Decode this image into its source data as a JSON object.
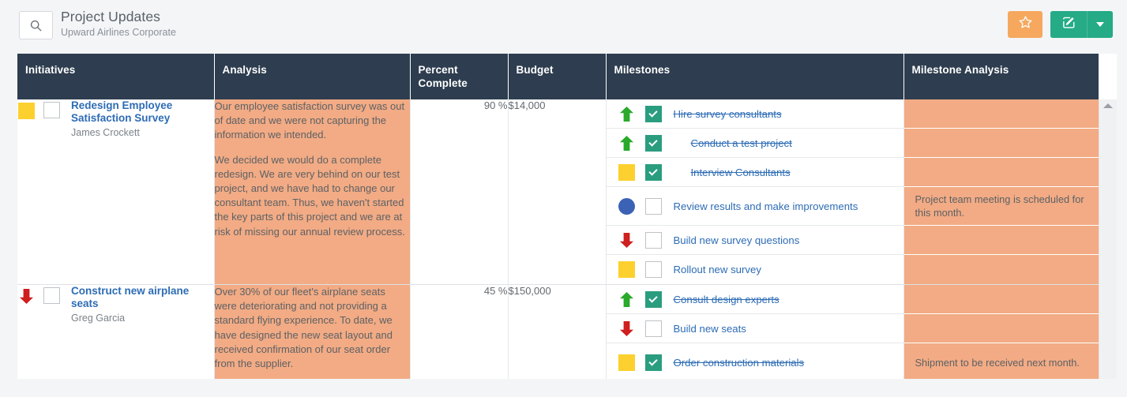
{
  "header": {
    "title": "Project Updates",
    "subtitle": "Upward Airlines Corporate",
    "search_icon": "search-icon",
    "star_icon": "star-icon",
    "edit_icon": "edit-pencil-icon",
    "caret_icon": "chevron-down-icon",
    "star_button_color": "#f5a85e",
    "edit_button_color": "#25ab86"
  },
  "columns": [
    {
      "key": "initiatives",
      "label": "Initiatives"
    },
    {
      "key": "analysis",
      "label": "Analysis"
    },
    {
      "key": "percent_complete",
      "label": "Percent Complete"
    },
    {
      "key": "budget",
      "label": "Budget"
    },
    {
      "key": "milestones",
      "label": "Milestones"
    },
    {
      "key": "milestone_analysis",
      "label": "Milestone Analysis"
    }
  ],
  "colors": {
    "header_bg": "#2e3d4f",
    "analysis_bg": "#f2ab84",
    "link": "#2d6cb5",
    "status_yellow": "#fcd02e",
    "status_green": "#2aa92a",
    "status_red": "#cf1f1f",
    "status_blue": "#3b62b5",
    "checkbox_checked": "#2a9d7f"
  },
  "rows": [
    {
      "status_icon": "yellow-square-status-icon",
      "status_type": "square-yellow",
      "checked": false,
      "title": "Redesign Employee Satisfaction Survey",
      "owner": "James Crockett",
      "analysis_paragraphs": [
        "Our employee satisfaction survey was out of date and we were not capturing the information we intended.",
        "We decided we would do a complete redesign. We are very behind on our test project, and we have had to change our consultant team. Thus, we haven't started the key parts of this project and we are at risk of missing our annual review process."
      ],
      "percent_complete": "90 %",
      "budget": "$14,000",
      "milestones": [
        {
          "status_icon": "green-up-arrow-status-icon",
          "status_type": "arrow-up-green",
          "checked": true,
          "label": "Hire survey consultants",
          "struck": true,
          "indent": false,
          "analysis": "",
          "tall": false
        },
        {
          "status_icon": "green-up-arrow-status-icon",
          "status_type": "arrow-up-green",
          "checked": true,
          "label": "Conduct a test project",
          "struck": true,
          "indent": true,
          "analysis": "",
          "tall": false
        },
        {
          "status_icon": "yellow-square-status-icon",
          "status_type": "square-yellow",
          "checked": true,
          "label": "Interview Consultants",
          "struck": true,
          "indent": true,
          "analysis": "",
          "tall": false
        },
        {
          "status_icon": "blue-circle-status-icon",
          "status_type": "circle-blue",
          "checked": false,
          "label": "Review results and make improvements",
          "struck": false,
          "indent": false,
          "analysis": "Project team meeting is scheduled for this month.",
          "tall": true
        },
        {
          "status_icon": "red-down-arrow-status-icon",
          "status_type": "arrow-down-red",
          "checked": false,
          "label": "Build new survey questions",
          "struck": false,
          "indent": false,
          "analysis": "",
          "tall": false
        },
        {
          "status_icon": "yellow-square-status-icon",
          "status_type": "square-yellow",
          "checked": false,
          "label": "Rollout new survey",
          "struck": false,
          "indent": false,
          "analysis": "",
          "tall": false
        }
      ]
    },
    {
      "status_icon": "red-down-arrow-status-icon",
      "status_type": "arrow-down-red",
      "checked": false,
      "title": "Construct new airplane seats",
      "owner": "Greg Garcia",
      "analysis_paragraphs": [
        "Over 30% of our fleet's airplane seats were deteriorating and not providing a standard flying experience. To date, we have designed the new seat layout and received confirmation of our seat order from the supplier."
      ],
      "percent_complete": "45 %",
      "budget": "$150,000",
      "milestones": [
        {
          "status_icon": "green-up-arrow-status-icon",
          "status_type": "arrow-up-green",
          "checked": true,
          "label": "Consult design experts",
          "struck": true,
          "indent": false,
          "analysis": "",
          "tall": false
        },
        {
          "status_icon": "red-down-arrow-status-icon",
          "status_type": "arrow-down-red",
          "checked": false,
          "label": "Build new seats",
          "struck": false,
          "indent": false,
          "analysis": "",
          "tall": false
        },
        {
          "status_icon": "yellow-square-status-icon",
          "status_type": "square-yellow",
          "checked": true,
          "label": "Order construction materials",
          "struck": true,
          "indent": false,
          "analysis": "Shipment to be received next month.",
          "tall": true
        }
      ]
    }
  ],
  "scrollbar": {
    "up_arrow_icon": "scroll-up-arrow-icon"
  }
}
